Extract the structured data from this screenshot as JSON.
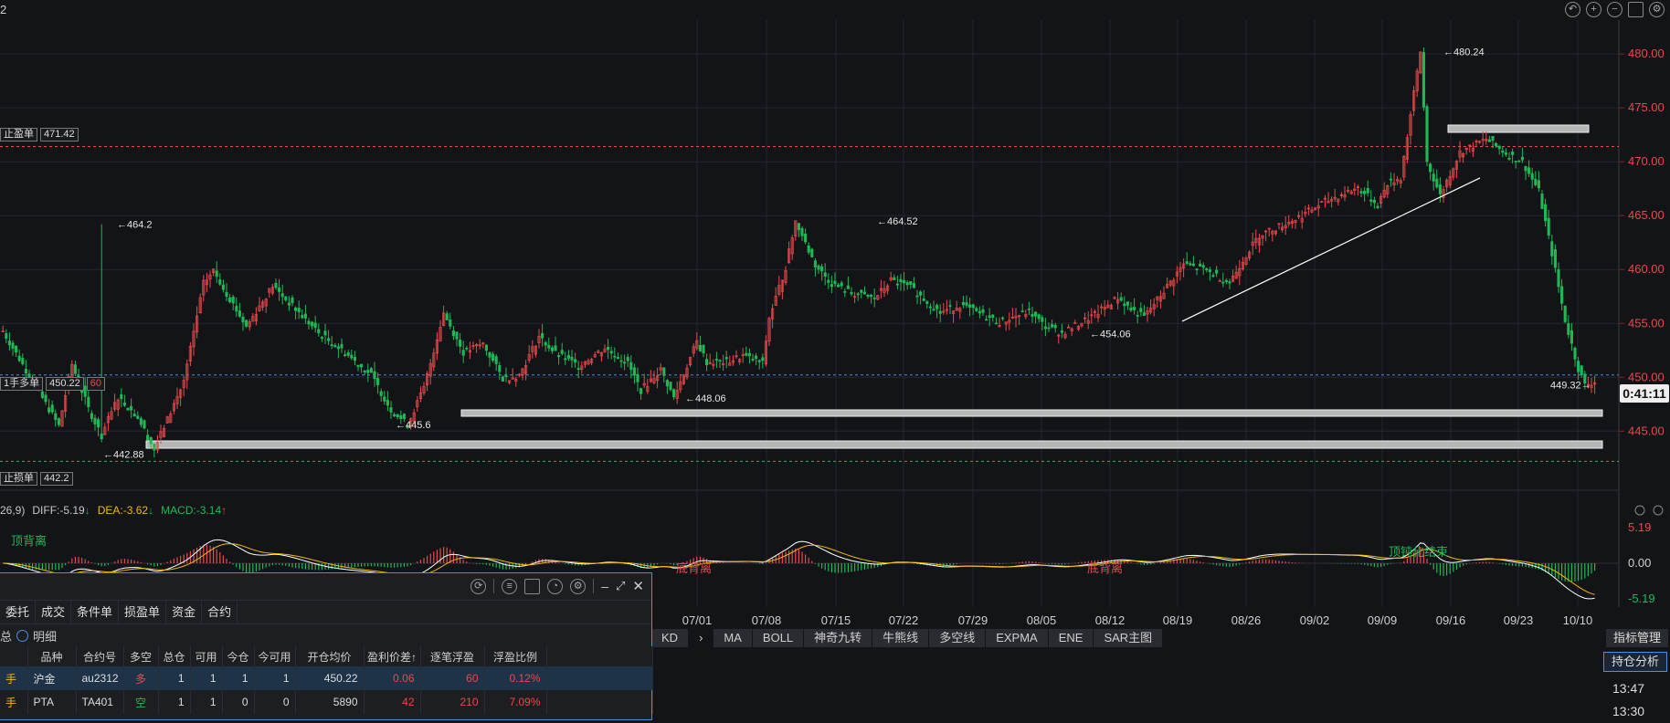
{
  "window": {
    "title": "2"
  },
  "colors": {
    "up": "#e84a4a",
    "down": "#1fb956",
    "background": "#131418",
    "accent": "#4a8fe0",
    "grid": "#24262c",
    "dea": "#f0b90b",
    "diff": "#ffffff"
  },
  "toolbar_icons": [
    "undo-icon",
    "zoom-in-icon",
    "zoom-out-icon",
    "layout-icon",
    "settings-icon"
  ],
  "chart_data": [
    {
      "type": "candlestick",
      "ylim": [
        442.4,
        481.2
      ],
      "yticks": [
        "480.00",
        "475.00",
        "470.00",
        "465.00",
        "460.00",
        "455.00",
        "450.00",
        "445.00"
      ],
      "xticks": [
        "07/01",
        "07/08",
        "07/15",
        "07/22",
        "07/29",
        "08/05",
        "08/12",
        "08/19",
        "08/26",
        "09/02",
        "09/09",
        "09/16",
        "09/23",
        "10/10"
      ],
      "grid": true,
      "annotations": [
        "464.2",
        "464.52",
        "480.24",
        "454.06",
        "448.06",
        "445.6",
        "442.88",
        "449.32"
      ],
      "order_lines": [
        {
          "label": "止盈单",
          "price": "471.42"
        },
        {
          "label": "1手多单",
          "price": "450.22",
          "pnl": "60"
        },
        {
          "label": "止损单",
          "price": "442.2"
        }
      ],
      "countdown": "0:41:11",
      "segments": [
        [
          0,
          454.3
        ],
        [
          17,
          445.5
        ],
        [
          21,
          451.2
        ],
        [
          26,
          447.1
        ],
        [
          30,
          444.6
        ],
        [
          35,
          448.2
        ],
        [
          41,
          446.3
        ],
        [
          46,
          443.3
        ],
        [
          55,
          449.6
        ],
        [
          61,
          458.7
        ],
        [
          64,
          459.9
        ],
        [
          74,
          454.7
        ],
        [
          82,
          458.5
        ],
        [
          96,
          454.1
        ],
        [
          104,
          452.3
        ],
        [
          112,
          450.2
        ],
        [
          118,
          447.0
        ],
        [
          123,
          445.6
        ],
        [
          128,
          449.0
        ],
        [
          134,
          456.0
        ],
        [
          140,
          452.3
        ],
        [
          146,
          453.1
        ],
        [
          152,
          449.9
        ],
        [
          157,
          450.2
        ],
        [
          163,
          453.8
        ],
        [
          168,
          452.2
        ],
        [
          175,
          451.1
        ],
        [
          183,
          452.7
        ],
        [
          190,
          451.3
        ],
        [
          194,
          448.8
        ],
        [
          200,
          450.7
        ],
        [
          204,
          448.1
        ],
        [
          211,
          453.3
        ],
        [
          214,
          451.4
        ],
        [
          220,
          451.4
        ],
        [
          225,
          452.0
        ],
        [
          231,
          451.3
        ],
        [
          233,
          455.5
        ],
        [
          238,
          460.2
        ],
        [
          241,
          464.5
        ],
        [
          247,
          460.4
        ],
        [
          252,
          458.7
        ],
        [
          258,
          457.8
        ],
        [
          265,
          457.3
        ],
        [
          270,
          459.0
        ],
        [
          276,
          458.3
        ],
        [
          285,
          456.0
        ],
        [
          291,
          456.7
        ],
        [
          303,
          455.1
        ],
        [
          312,
          456.1
        ],
        [
          317,
          454.7
        ],
        [
          322,
          454.1
        ],
        [
          332,
          455.8
        ],
        [
          339,
          457.4
        ],
        [
          343,
          456.3
        ],
        [
          347,
          455.6
        ],
        [
          352,
          457.6
        ],
        [
          359,
          460.5
        ],
        [
          366,
          459.9
        ],
        [
          373,
          458.8
        ],
        [
          377,
          460.9
        ],
        [
          382,
          463.2
        ],
        [
          393,
          464.7
        ],
        [
          402,
          466.3
        ],
        [
          412,
          467.6
        ],
        [
          418,
          466.0
        ],
        [
          421,
          468.0
        ],
        [
          425,
          468.5
        ],
        [
          431,
          480.2
        ],
        [
          433,
          470.0
        ],
        [
          437,
          466.9
        ],
        [
          443,
          470.9
        ],
        [
          451,
          472.1
        ],
        [
          457,
          470.8
        ],
        [
          462,
          470.0
        ],
        [
          467,
          467.3
        ],
        [
          471,
          461.5
        ],
        [
          475,
          455.3
        ],
        [
          479,
          450.8
        ],
        [
          481,
          449.3
        ],
        [
          484,
          449.6
        ]
      ]
    },
    {
      "type": "macd",
      "params": "26,9)",
      "diff": "-5.19",
      "dea": "-3.62",
      "macd": "-3.14",
      "ylim_labels": [
        "5.19",
        "0.00",
        "-5.19"
      ],
      "signals": [
        "顶背离",
        "底背离",
        "底背离",
        "顶钝化结束"
      ]
    }
  ],
  "indicator_tabs": [
    "KD",
    "MA",
    "BOLL",
    "神奇九转",
    "牛熊线",
    "多空线",
    "EXPMA",
    "ENE",
    "SAR主图"
  ],
  "indicator_manager": "指标管理",
  "position_analysis": "持仓分析",
  "clock_times": [
    "13:47",
    "13:30"
  ],
  "panel": {
    "tabs": [
      "委托",
      "成交",
      "条件单",
      "损盈单",
      "资金",
      "合约"
    ],
    "toggle_left": "总",
    "toggle_label": "明细",
    "columns": [
      "品种",
      "合约号",
      "多空",
      "总仓",
      "可用",
      "今仓",
      "今可用",
      "开仓均价",
      "盈利价差↑",
      "逐笔浮盈",
      "浮盈比例"
    ],
    "rows": [
      {
        "lots": "手",
        "product": "沪金",
        "contract": "au2312",
        "dir": "多",
        "total": "1",
        "avail": "1",
        "today": "1",
        "today_avail": "1",
        "avg": "450.22",
        "spread": "0.06",
        "pnl": "60",
        "ratio": "0.12%"
      },
      {
        "lots": "手",
        "product": "PTA",
        "contract": "TA401",
        "dir": "空",
        "total": "1",
        "avail": "1",
        "today": "0",
        "today_avail": "0",
        "avg": "5890",
        "spread": "42",
        "pnl": "210",
        "ratio": "7.09%"
      }
    ]
  }
}
